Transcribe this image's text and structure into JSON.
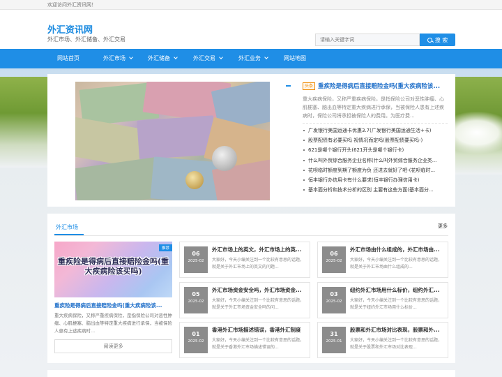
{
  "topbar": {
    "welcome": "欢迎访问外汇资讯网！"
  },
  "header": {
    "title": "外汇资讯网",
    "subtitle": "外汇市场、外汇储备、外汇交易",
    "search_placeholder": "请输入关键字词",
    "search_button": "搜 索"
  },
  "nav": {
    "items": [
      {
        "label": "网站首页"
      },
      {
        "label": "外汇市场"
      },
      {
        "label": "外汇储备"
      },
      {
        "label": "外汇交易"
      },
      {
        "label": "外汇业务"
      },
      {
        "label": "网站地图"
      }
    ]
  },
  "hero": {
    "tag": "头条",
    "title": "重疾险是得病后直接赔险金吗(重大疾病险该...",
    "summary": "重大疾病保险，又称严重疾病保险，是指保险公司对恶性肿瘤、心肌梗塞、脑出血等特定重大疾病进行承保，当被保险人患有上述疾病时，保险公司将承担被保险人的费用。为医疗费...",
    "list": [
      "广发银行美国运通卡优惠3.7(广发银行美国运通生活+卡)",
      "股票配债有必要买吗 视情况而定吗(股票配债要买吗-)",
      "621是哪个银行开头(621开头是哪个银行卡)",
      "什么叫外贸综合服务企业名称(什么叫外贸综合服务企业类...",
      "花呗临时额度到期了额度为负 还进去就好了吧-(花呗临时...",
      "恒丰银行办信用卡有什么要求(恒丰银行办理信用卡)",
      "基本面分析和技术分析的区别 主要有这些方面(基本面分..."
    ]
  },
  "section": {
    "title": "外汇市场",
    "more": "更多",
    "featured": {
      "badge": "推荐",
      "image_text": "重疾险是得病后直接赔险金吗(重大疾病险该买吗)",
      "title": "重疾险是得病后直接赔险金吗(重大疾病险该...",
      "desc": "重大疾病保险，又称严重疾病保险，是指保险公司对恶性肿瘤、心肌梗塞、脑出血等特定重大疾病进行承保，当被保险人患有上述疾病时...",
      "button": "阅读更多"
    },
    "articles": [
      {
        "day": "06",
        "ym": "2025-02",
        "title": "外汇市场上的英文，外汇市场上的英...",
        "desc": "大家好，今天小编关注到一个比较有意思的话题，就是关于外汇市场上的英文的问题..."
      },
      {
        "day": "06",
        "ym": "2025-02",
        "title": "外汇市场由什么组成的，外汇市场由...",
        "desc": "大家好，今天小编关注到一个比较有意思的话题，就是关于外汇市场由什么组成的..."
      },
      {
        "day": "05",
        "ym": "2025-02",
        "title": "外汇市场资金安全吗，外汇市场资金...",
        "desc": "大家好，今天小编关注到一个比较有意思的话题，就是关于外汇市场资金安全吗的问..."
      },
      {
        "day": "03",
        "ym": "2025-02",
        "title": "纽约外汇市场用什么标价，纽约外汇...",
        "desc": "大家好，今天小编关注到一个比较有意思的话题，就是关于纽约外汇市场用什么标价..."
      },
      {
        "day": "01",
        "ym": "2025-02",
        "title": "香港外汇市场描述错误，香港外汇制度",
        "desc": "大家好，今天小编关注到一个比较有意思的话题，就是关于香港外汇市场描述错误的..."
      },
      {
        "day": "31",
        "ym": "2025-01",
        "title": "股票和外汇市场对比表现，股票和外...",
        "desc": "大家好，今天小编关注到一个比较有意思的话题，就是关于股票和外汇市场对比表现..."
      }
    ]
  },
  "colors": {
    "accent": "#1f8ee6",
    "link": "#1f6fc9",
    "tag": "#f08a00",
    "date_box": "#8c8c8c"
  }
}
